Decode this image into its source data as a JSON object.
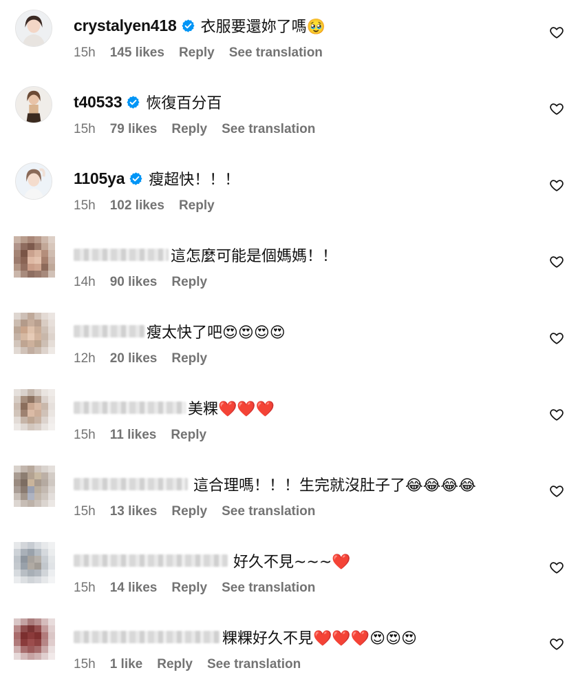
{
  "comments": [
    {
      "username": "crystalyen418",
      "verified": true,
      "text": "衣服要還妳了嗎🥹",
      "time": "15h",
      "likes": "145 likes",
      "reply": "Reply",
      "translation": "See translation"
    },
    {
      "username": "t40533",
      "verified": true,
      "text": "恢復百分百",
      "time": "15h",
      "likes": "79 likes",
      "reply": "Reply",
      "translation": "See translation"
    },
    {
      "username": "1105ya",
      "verified": true,
      "text": "瘦超快！！！",
      "time": "15h",
      "likes": "102 likes",
      "reply": "Reply",
      "translation": ""
    },
    {
      "username": "",
      "verified": false,
      "text": "這怎麼可能是個媽媽！！",
      "time": "14h",
      "likes": "90 likes",
      "reply": "Reply",
      "translation": ""
    },
    {
      "username": "",
      "verified": false,
      "text": "瘦太快了吧😍😍😍😍",
      "time": "12h",
      "likes": "20 likes",
      "reply": "Reply",
      "translation": ""
    },
    {
      "username": "",
      "verified": false,
      "text": "美粿❤️❤️❤️",
      "time": "15h",
      "likes": "11 likes",
      "reply": "Reply",
      "translation": ""
    },
    {
      "username": "",
      "verified": false,
      "text": "這合理嗎！！！生完就沒肚子了😂😂😂😂",
      "time": "15h",
      "likes": "13 likes",
      "reply": "Reply",
      "translation": "See translation"
    },
    {
      "username": "",
      "verified": false,
      "text": "好久不見~~~❤️",
      "time": "15h",
      "likes": "14 likes",
      "reply": "Reply",
      "translation": "See translation"
    },
    {
      "username": "",
      "verified": false,
      "text": "粿粿好久不見❤️❤️❤️😍😍😍",
      "time": "15h",
      "likes": "1 like",
      "reply": "Reply",
      "translation": "See translation"
    }
  ],
  "icons": {
    "like": "heart-outline-icon",
    "verified": "verified-badge-icon"
  },
  "colors": {
    "verified": "#0095f6",
    "meta": "#737373",
    "text": "#111111"
  }
}
